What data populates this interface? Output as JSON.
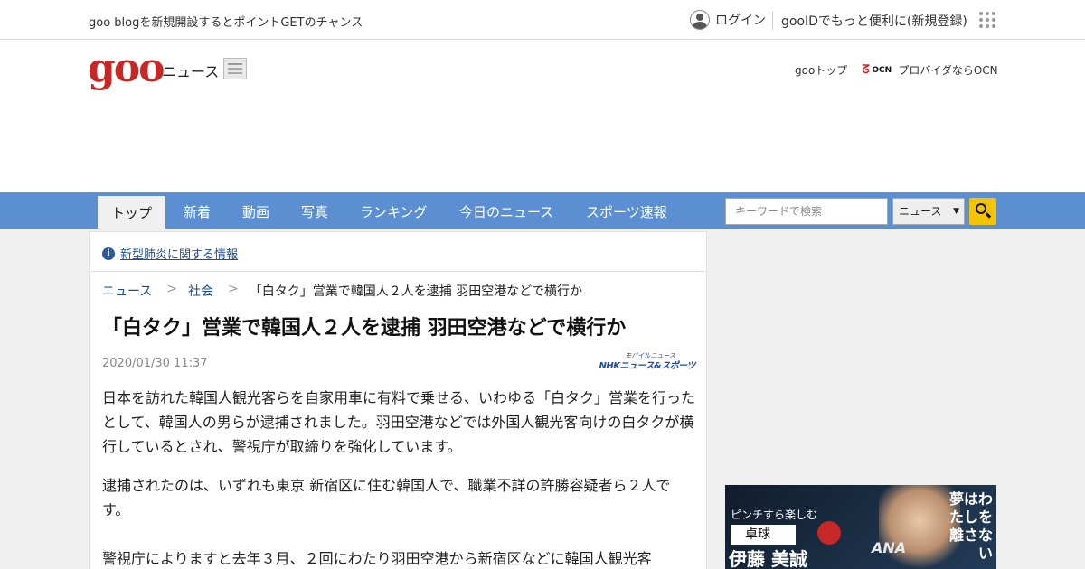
{
  "topbar": {
    "promo": "goo blogを新規開設するとポイントGETのチャンス",
    "login": "ログイン",
    "register": "gooIDでもっと便利に(新規登録)"
  },
  "header": {
    "logo": "goo",
    "section": "ニュース",
    "links": {
      "goo_top": "gooトップ",
      "ocn_logo_text": "OCN",
      "ocn": "プロバイダならOCN"
    }
  },
  "nav": {
    "tabs": [
      "トップ",
      "新着",
      "動画",
      "写真",
      "ランキング",
      "今日のニュース",
      "スポーツ速報"
    ],
    "search_placeholder": "キーワードで検索",
    "select_value": "ニュース"
  },
  "article": {
    "notice": "新型肺炎に関する情報",
    "breadcrumb": [
      "ニュース",
      "社会",
      "「白タク」営業で韓国人２人を逮捕 羽田空港などで横行か"
    ],
    "title": "「白タク」営業で韓国人２人を逮捕 羽田空港などで横行か",
    "date": "2020/01/30 11:37",
    "source_small": "モバイルニュース",
    "source": "NHKニュース&スポーツ",
    "paragraphs": [
      "日本を訪れた韓国人観光客らを自家用車に有料で乗せる、いわゆる「白タク」営業を行ったとして、韓国人の男らが逮捕されました。羽田空港などでは外国人観光客向けの白タクが横行しているとされ、警視庁が取締りを強化しています。",
      "逮捕されたのは、いずれも東京 新宿区に住む韓国人で、職業不詳の許勝容疑者ら２人です。",
      "警視庁によりますと去年３月、２回にわたり羽田空港から新宿区などに韓国人観光客"
    ]
  },
  "ad": {
    "line1": "ピンチすら楽しむ",
    "sport": "卓球",
    "name": "伊藤 美誠",
    "tagline": "夢はわたしを離さない",
    "brand": "ANA"
  }
}
